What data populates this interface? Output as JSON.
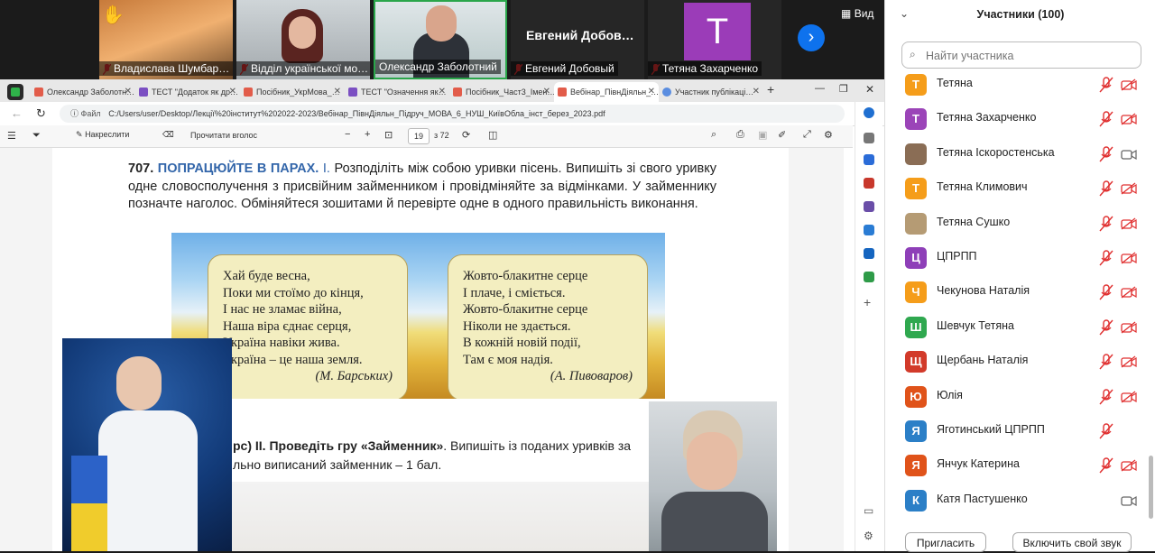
{
  "video_strip": {
    "tiles": [
      {
        "name": "Владислава Шумбар…"
      },
      {
        "name": "Відділ української мо…"
      },
      {
        "name": "Олександр Заболотний"
      },
      {
        "name": "Евгений Добовый",
        "big_label": "Евгений Добов…"
      },
      {
        "name": "Тетяна Захарченко",
        "initial": "T"
      }
    ],
    "view_label": "Вид"
  },
  "browser": {
    "tabs": [
      {
        "label": "Олександр Заболотн…"
      },
      {
        "label": "ТЕСТ \"Додаток як др…"
      },
      {
        "label": "Посібник_УкрМова_…"
      },
      {
        "label": "ТЕСТ \"Означення як…"
      },
      {
        "label": "Посібник_Част3_Імен…"
      },
      {
        "label": "Вебінар_ПівнДіяльн_…"
      },
      {
        "label": "Участник публікаці…"
      }
    ],
    "file_label": "Файл",
    "url": "C:/Users/user/Desktop/Лекції%20інститут%202022-2023/Вебінар_ПівнДіяльн_Підруч_МОВА_6_НУШ_КиївОбла_інст_берез_2023.pdf",
    "pdf_toolbar": {
      "draw_label": "Накреслити",
      "read_aloud_label": "Прочитати вголос",
      "page_current": "19",
      "page_total": "з 72"
    }
  },
  "document": {
    "task_number": "707.",
    "task_heading": "ПОПРАЦЮЙТЕ В ПАРАХ.",
    "task_part": "I.",
    "task_text": "Розподіліть між собою уривки пісень. Випишіть зі свого уривку одне словосполучення з присвійним займенником і провідміняйте за відмінками. У займеннику позначте наголос. Обміняйтеся зошитами й перевірте одне в одного правильність виконання.",
    "poem_left": {
      "lines": [
        "Хай буде весна,",
        "Поки ми стоїмо до кінця,",
        "І нас не зламає війна,",
        "Наша віра єднає серця,",
        "Україна навіки жива.",
        "Україна – це наша земля."
      ],
      "author": "(М. Барських)"
    },
    "poem_right": {
      "lines": [
        "Жовто-блакитне серце",
        "І плаче, і сміється.",
        "Жовто-блакитне серце",
        "Ніколи не здається.",
        "В кожній новій події,",
        "Там є моя надія."
      ],
      "author": "(А. Пивоваров)"
    },
    "task2_pre": "рс) II. Проведіть",
    "task2_bold": "гру «Займенник»",
    "task2_post": ". Випишіть із поданих уривків за",
    "task2_line2": "льно виписаний займенник – 1 бал."
  },
  "participants": {
    "title": "Участники (100)",
    "search_placeholder": "Найти участника",
    "list": [
      {
        "initial": "Т",
        "name": "Тетяна",
        "color": "#f59d1a",
        "mic_muted": true,
        "cam": "off"
      },
      {
        "initial": "Т",
        "name": "Тетяна Захарченко",
        "color": "#9b44b8",
        "mic_muted": true,
        "cam": "off"
      },
      {
        "initial": "",
        "name": "Тетяна Іскоростенська",
        "color": "#8a6d55",
        "mic_muted": true,
        "cam": "on"
      },
      {
        "initial": "Т",
        "name": "Тетяна Климович",
        "color": "#f59d1a",
        "mic_muted": true,
        "cam": "off"
      },
      {
        "initial": "",
        "name": "Тетяна Сушко",
        "color": "#b59b74",
        "mic_muted": true,
        "cam": "off"
      },
      {
        "initial": "Ц",
        "name": "ЦПРПП",
        "color": "#8e3fb8",
        "mic_muted": true,
        "cam": "off"
      },
      {
        "initial": "Ч",
        "name": "Чекунова Наталія",
        "color": "#f59d1a",
        "mic_muted": true,
        "cam": "off"
      },
      {
        "initial": "Ш",
        "name": "Шевчук Тетяна",
        "color": "#2fa84f",
        "mic_muted": true,
        "cam": "off"
      },
      {
        "initial": "Щ",
        "name": "Щербань Наталія",
        "color": "#d23a2a",
        "mic_muted": true,
        "cam": "off"
      },
      {
        "initial": "Ю",
        "name": "Юлія",
        "color": "#e0531a",
        "mic_muted": true,
        "cam": "off"
      },
      {
        "initial": "Я",
        "name": "Яготинський ЦПРПП",
        "color": "#2b7fc7",
        "mic_muted": true,
        "cam": "none"
      },
      {
        "initial": "Я",
        "name": "Янчук Катерина",
        "color": "#e0531a",
        "mic_muted": true,
        "cam": "off"
      },
      {
        "initial": "К",
        "name": "Катя Пастушенко",
        "color": "#2b7fc7",
        "mic_muted": false,
        "cam": "on"
      }
    ],
    "invite_label": "Пригласить",
    "unmute_all_label": "Включить свой звук"
  }
}
